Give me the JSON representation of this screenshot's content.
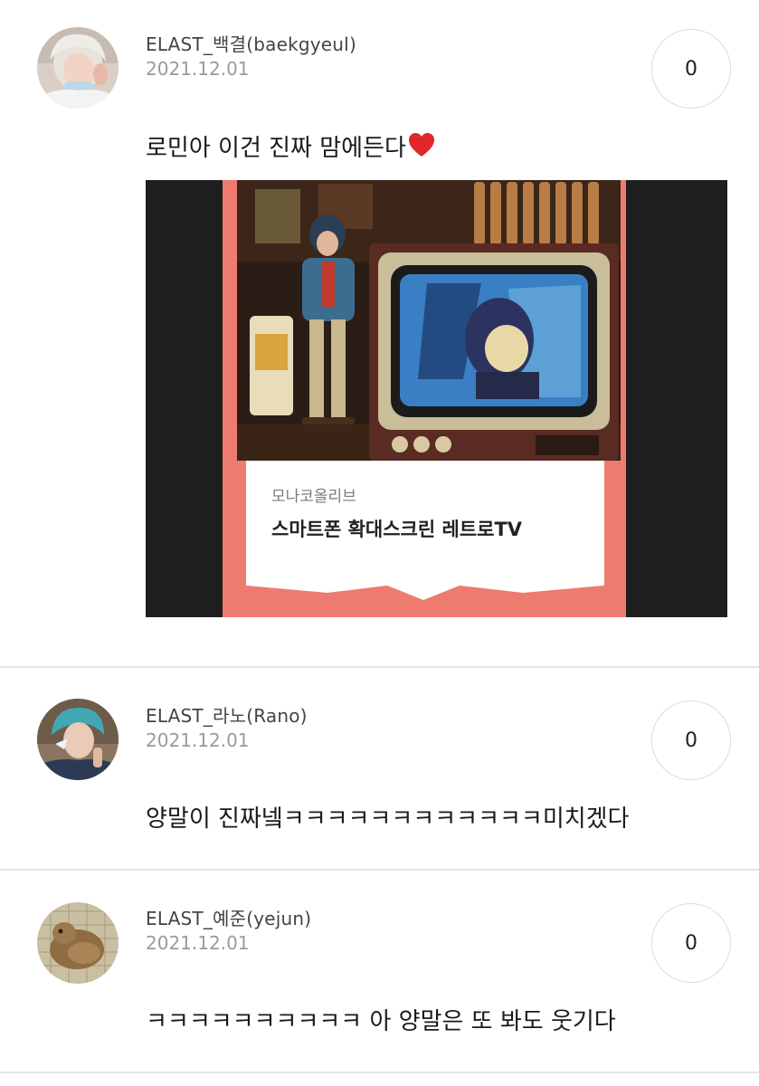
{
  "comments": [
    {
      "username": "ELAST_백결(baekgyeul)",
      "date": "2021.12.01",
      "likes": "0",
      "text": "로민아 이건 진짜 맘에든다",
      "emoji": "heart-icon",
      "attachment": {
        "brand": "모나코올리브",
        "title": "스마트폰 확대스크린 레트로TV"
      }
    },
    {
      "username": "ELAST_라노(Rano)",
      "date": "2021.12.01",
      "likes": "0",
      "text": "양말이 진짜넼ㅋㅋㅋㅋㅋㅋㅋㅋㅋㅋㅋㅋ미치겠다"
    },
    {
      "username": "ELAST_예준(yejun)",
      "date": "2021.12.01",
      "likes": "0",
      "text": "ㅋㅋㅋㅋㅋㅋㅋㅋㅋㅋ 아 양말은 또 봐도 웃기다"
    }
  ],
  "colors": {
    "card_background": "#ee7b6f",
    "divider": "#e4e4e4",
    "heart": "#e0262a"
  }
}
